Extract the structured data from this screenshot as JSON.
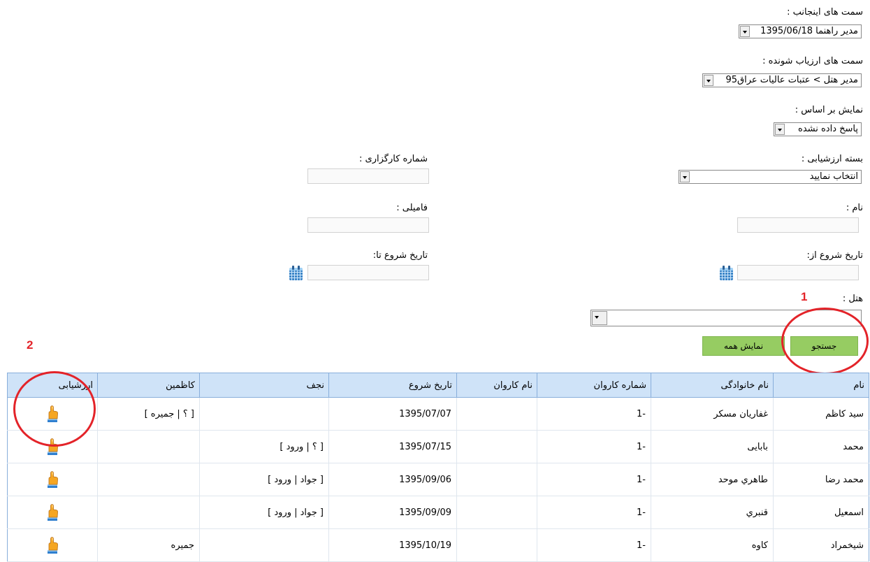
{
  "form": {
    "my_positions": {
      "label": "سمت های اینجانب :",
      "value": "مدیر راهنما 1395/06/18"
    },
    "evaluated_positions": {
      "label": "سمت های ارزیاب شونده :",
      "value": "مدیر هتل > عتبات عالیات عراق95"
    },
    "display_by": {
      "label": "نمایش بر اساس :",
      "value": "پاسخ داده نشده"
    },
    "evaluation_package": {
      "label": "بسته ارزشیابی :",
      "value": "انتخاب نمایید"
    },
    "agency_number": {
      "label": "شماره کارگزاری :",
      "value": ""
    },
    "first_name": {
      "label": "نام :",
      "value": ""
    },
    "last_name": {
      "label": "فامیلی :",
      "value": ""
    },
    "start_date_from": {
      "label": "تاریخ شروع از:",
      "value": ""
    },
    "start_date_to": {
      "label": "تاریخ شروع تا:",
      "value": ""
    },
    "hotel": {
      "label": "هتل :",
      "value": ""
    },
    "search_button": "جستجو",
    "show_all_button": "نمایش همه"
  },
  "annotations": {
    "marker_1": "1",
    "marker_2": "2",
    "color": "#e32329"
  },
  "table": {
    "columns": [
      "نام",
      "نام خانوادگی",
      "شماره کاروان",
      "نام کاروان",
      "تاریخ شروع",
      "نجف",
      "کاظمین",
      "ارزشیابی"
    ],
    "rows": [
      {
        "name": "سید کاظم",
        "family": "غفاریان مسکر",
        "caravan_no": "1-",
        "caravan_name": "",
        "start": "1395/07/07",
        "najaf": "",
        "kazimain": "[ ؟ | جمیره ]",
        "eval_icon": "hand-pointer-icon"
      },
      {
        "name": "محمد",
        "family": "بابایی",
        "caravan_no": "1-",
        "caravan_name": "",
        "start": "1395/07/15",
        "najaf": "[ ؟ | ورود ]",
        "kazimain": "",
        "eval_icon": "hand-pointer-icon"
      },
      {
        "name": "محمد رضا",
        "family": "طاهري موحد",
        "caravan_no": "1-",
        "caravan_name": "",
        "start": "1395/09/06",
        "najaf": "[ جواد | ورود ]",
        "kazimain": "",
        "eval_icon": "hand-pointer-icon"
      },
      {
        "name": "اسمعیل",
        "family": "قنبري",
        "caravan_no": "1-",
        "caravan_name": "",
        "start": "1395/09/09",
        "najaf": "[ جواد | ورود ]",
        "kazimain": "",
        "eval_icon": "hand-pointer-icon"
      },
      {
        "name": "شیخمراد",
        "family": "کاوه",
        "caravan_no": "1-",
        "caravan_name": "",
        "start": "1395/10/19",
        "najaf": "",
        "kazimain": "جمیره",
        "eval_icon": "hand-pointer-icon"
      }
    ]
  },
  "colors": {
    "header_bg": "#cfe3f8",
    "header_border": "#88aedb",
    "button_green": "#96cc62"
  }
}
